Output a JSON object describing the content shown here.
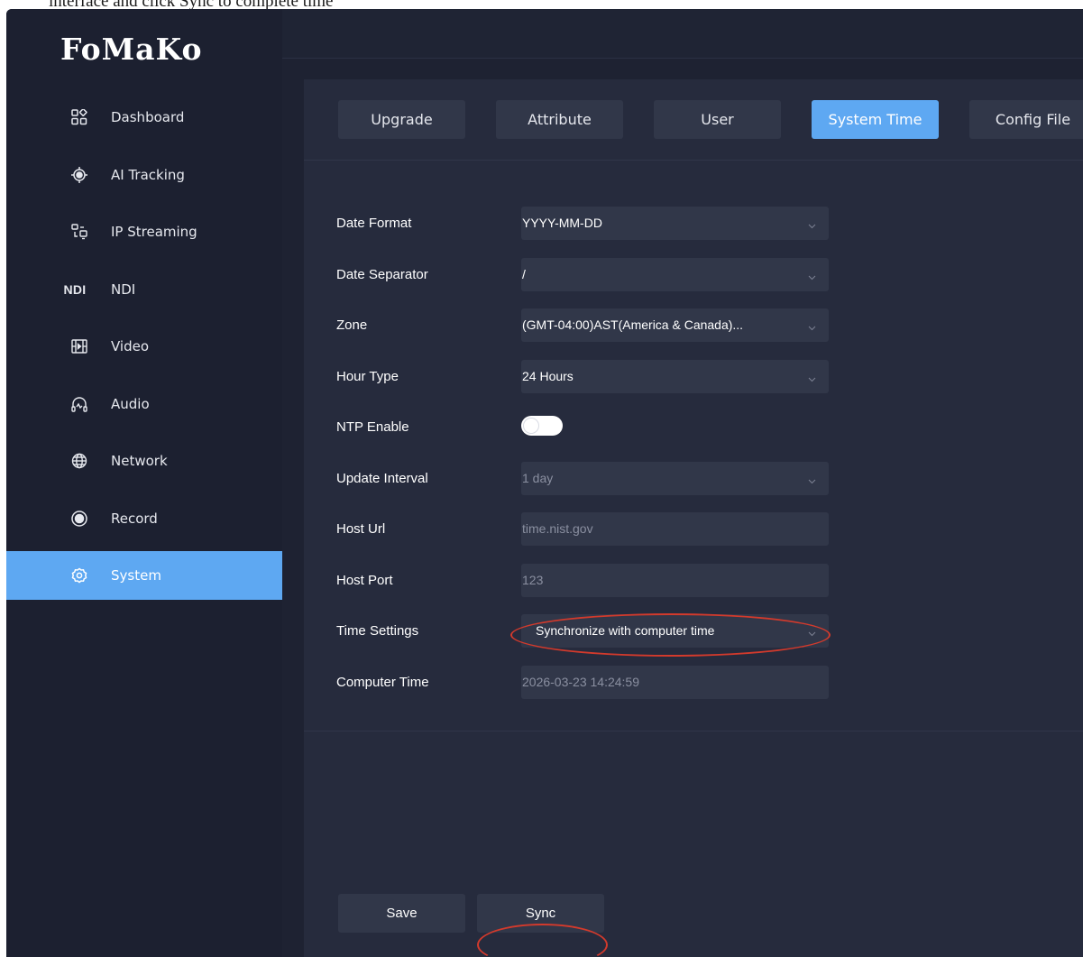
{
  "caption": "interface and click Sync to complete time",
  "brand": "FoMaKo",
  "sidebar": {
    "items": [
      {
        "label": "Dashboard",
        "icon": "dashboard-icon"
      },
      {
        "label": "AI Tracking",
        "icon": "target-icon"
      },
      {
        "label": "IP Streaming",
        "icon": "ip-streaming-icon"
      },
      {
        "label": "NDI",
        "icon_text": "NDI"
      },
      {
        "label": "Video",
        "icon": "video-icon"
      },
      {
        "label": "Audio",
        "icon": "audio-icon"
      },
      {
        "label": "Network",
        "icon": "globe-icon"
      },
      {
        "label": "Record",
        "icon": "record-icon"
      },
      {
        "label": "System",
        "icon": "gear-icon",
        "active": true
      }
    ]
  },
  "tabs": [
    {
      "label": "Upgrade"
    },
    {
      "label": "Attribute"
    },
    {
      "label": "User"
    },
    {
      "label": "System Time",
      "active": true
    },
    {
      "label": "Config File"
    }
  ],
  "form": {
    "date_format": {
      "label": "Date Format",
      "value": "YYYY-MM-DD"
    },
    "date_separator": {
      "label": "Date Separator",
      "value": "/"
    },
    "zone": {
      "label": "Zone",
      "value": "(GMT-04:00)AST(America & Canada)..."
    },
    "hour_type": {
      "label": "Hour Type",
      "value": "24 Hours"
    },
    "ntp_enable": {
      "label": "NTP Enable",
      "on": false
    },
    "update_interval": {
      "label": "Update Interval",
      "value": "1 day"
    },
    "host_url": {
      "label": "Host Url",
      "value": "time.nist.gov"
    },
    "host_port": {
      "label": "Host Port",
      "value": "123"
    },
    "time_settings": {
      "label": "Time Settings",
      "value": "Synchronize with computer time"
    },
    "computer_time": {
      "label": "Computer Time",
      "value": "2026-03-23 14:24:59"
    }
  },
  "footer": {
    "save_label": "Save",
    "sync_label": "Sync"
  },
  "colors": {
    "accent": "#5ea8f2",
    "annotation": "#d33a2c"
  }
}
